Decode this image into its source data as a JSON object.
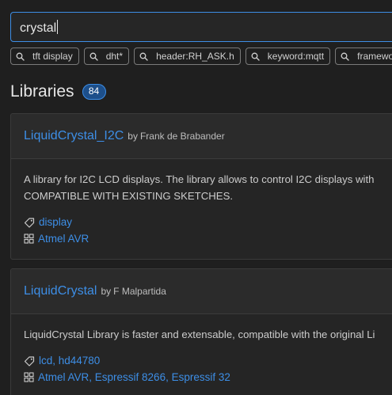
{
  "search": {
    "value": "crystal"
  },
  "suggestions": [
    {
      "label": "tft display"
    },
    {
      "label": "dht*"
    },
    {
      "label": "header:RH_ASK.h"
    },
    {
      "label": "keyword:mqtt"
    },
    {
      "label": "framework"
    }
  ],
  "section": {
    "title": "Libraries",
    "count": "84"
  },
  "libraries": [
    {
      "name": "LiquidCrystal_I2C",
      "by": "by",
      "author": "Frank de Brabander",
      "description_lines": [
        "A library for I2C LCD displays. The library allows to control I2C displays with",
        "COMPATIBLE WITH EXISTING SKETCHES."
      ],
      "keywords": "display",
      "platforms": "Atmel AVR"
    },
    {
      "name": "LiquidCrystal",
      "by": "by",
      "author": "F Malpartida",
      "description_lines": [
        "LiquidCrystal Library is faster and extensable, compatible with the original Li"
      ],
      "keywords": "lcd, hd44780",
      "platforms": "Atmel AVR, Espressif 8266, Espressif 32"
    }
  ],
  "colors": {
    "accent": "#3d8ee6",
    "background": "#1f1f1f",
    "card": "#252525",
    "badge": "#1d4f8a"
  }
}
